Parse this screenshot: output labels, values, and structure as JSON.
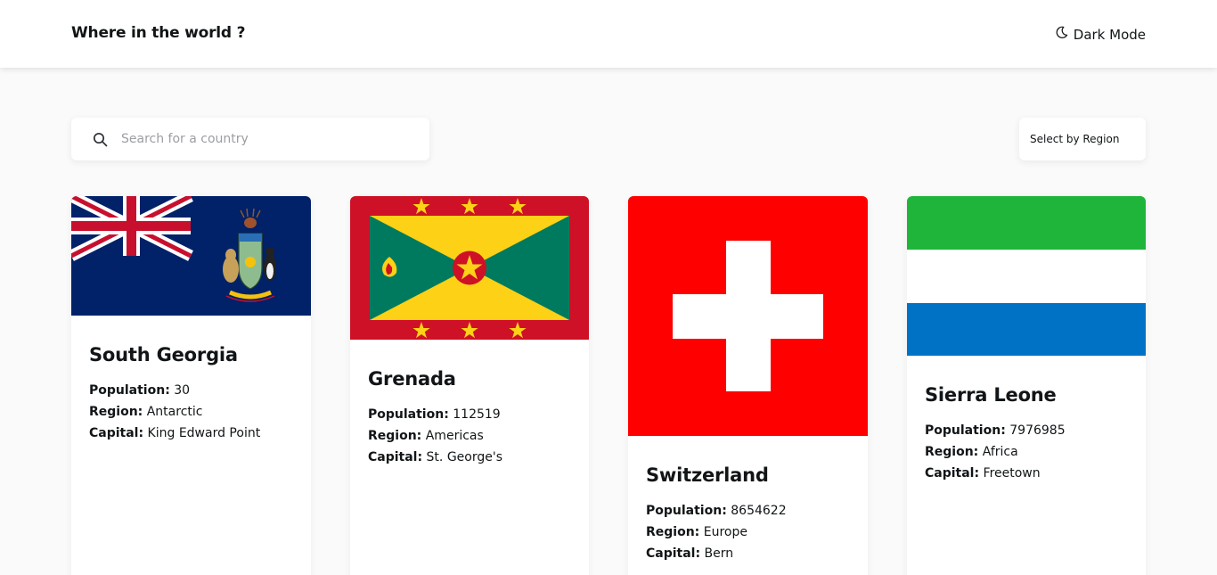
{
  "header": {
    "title": "Where in the world ?",
    "dark_mode_label": "Dark Mode"
  },
  "search": {
    "placeholder": "Search for a country",
    "value": ""
  },
  "filter": {
    "label": "Select by Region"
  },
  "labels": {
    "population": "Population:",
    "region": "Region:",
    "capital": "Capital:"
  },
  "countries": [
    {
      "name": "South Georgia",
      "population": "30",
      "region": "Antarctic",
      "capital": "King Edward Point"
    },
    {
      "name": "Grenada",
      "population": "112519",
      "region": "Americas",
      "capital": "St. George's"
    },
    {
      "name": "Switzerland",
      "population": "8654622",
      "region": "Europe",
      "capital": "Bern"
    },
    {
      "name": "Sierra Leone",
      "population": "7976985",
      "region": "Africa",
      "capital": "Freetown"
    }
  ],
  "colors": {
    "background": "#fafafa",
    "element": "#ffffff",
    "text": "#111517",
    "placeholder": "#9b9ea3"
  }
}
